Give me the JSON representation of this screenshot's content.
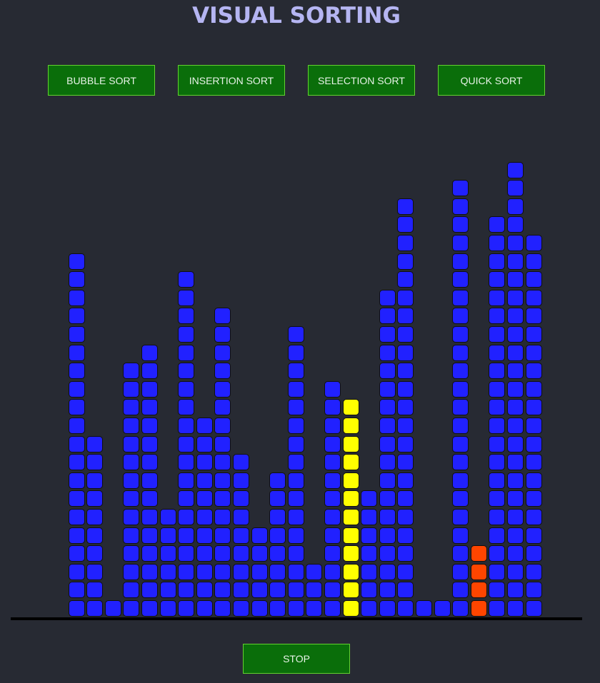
{
  "title": "VISUAL SORTING",
  "buttons": {
    "bubble": "BUBBLE SORT",
    "insertion": "INSERTION SORT",
    "selection": "SELECTION SORT",
    "quick": "QUICK SORT",
    "stop": "STOP"
  },
  "colors": {
    "background": "#272a33",
    "title": "#b5b5f2",
    "button_bg": "#0a6e0a",
    "button_border": "#62d130",
    "bar_default": "#2121ff",
    "bar_compare": "#ffff00",
    "bar_swap": "#ff4500",
    "cell_border": "#101010"
  },
  "bars": {
    "heights": [
      20,
      10,
      1,
      14,
      15,
      6,
      19,
      11,
      17,
      9,
      5,
      8,
      16,
      3,
      13,
      12,
      7,
      18,
      23,
      1,
      1,
      24,
      4,
      22,
      25,
      21
    ],
    "states": [
      "default",
      "default",
      "default",
      "default",
      "default",
      "default",
      "default",
      "default",
      "default",
      "default",
      "default",
      "default",
      "default",
      "default",
      "default",
      "compare",
      "default",
      "default",
      "default",
      "default",
      "default",
      "default",
      "swap",
      "default",
      "default",
      "default"
    ]
  }
}
